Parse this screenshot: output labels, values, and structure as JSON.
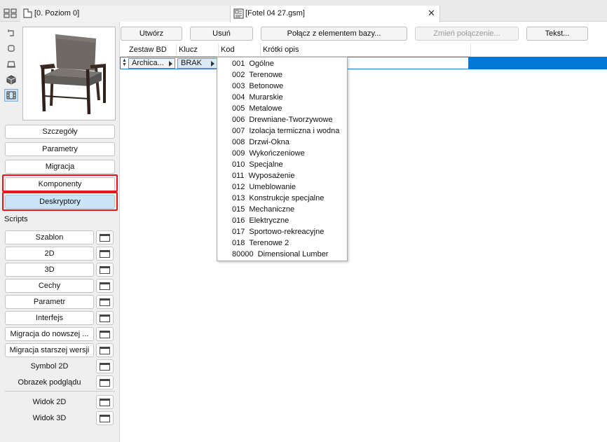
{
  "tabs": [
    {
      "label": "[0. Poziom 0]"
    },
    {
      "label": "[Fotel 04 27.gsm]"
    }
  ],
  "left": {
    "buttons": {
      "szczegoly": "Szczegóły",
      "parametry": "Parametry",
      "migracja": "Migracja",
      "komponenty": "Komponenty",
      "deskryptory": "Deskryptory"
    },
    "scripts_label": "Scripts",
    "scripts": {
      "szablon": "Szablon",
      "s2d": "2D",
      "s3d": "3D",
      "cechy": "Cechy",
      "parametr": "Parametr",
      "interfejs": "Interfejs",
      "migracja_nowsza": "Migracja do nowszej ...",
      "migracja_starsza": "Migracja starszej wersji",
      "symbol2d": "Symbol 2D",
      "obrazek": "Obrazek podglądu",
      "widok2d": "Widok 2D",
      "widok3d": "Widok 3D"
    }
  },
  "toolbar": {
    "utworz": "Utwórz",
    "usun": "Usuń",
    "polacz": "Połącz z elementem bazy...",
    "zmien": "Zmień połączenie...",
    "tekst": "Tekst..."
  },
  "table": {
    "headers": {
      "zestaw": "Zestaw BD",
      "klucz": "Klucz",
      "kod": "Kod",
      "opis": "Krótki opis"
    },
    "row": {
      "zestaw": "Archica...",
      "klucz": "BRAK"
    }
  },
  "dropdown": [
    {
      "code": "001",
      "label": "Ogólne"
    },
    {
      "code": "002",
      "label": "Terenowe"
    },
    {
      "code": "003",
      "label": "Betonowe"
    },
    {
      "code": "004",
      "label": "Murarskie"
    },
    {
      "code": "005",
      "label": "Metalowe"
    },
    {
      "code": "006",
      "label": "Drewniane-Tworzywowe"
    },
    {
      "code": "007",
      "label": "Izolacja termiczna i wodna"
    },
    {
      "code": "008",
      "label": "Drzwi-Okna"
    },
    {
      "code": "009",
      "label": "Wykończeniowe"
    },
    {
      "code": "010",
      "label": "Specjalne"
    },
    {
      "code": "011",
      "label": "Wyposażenie"
    },
    {
      "code": "012",
      "label": "Umeblowanie"
    },
    {
      "code": "013",
      "label": "Konstrukcje specjalne"
    },
    {
      "code": "015",
      "label": "Mechaniczne"
    },
    {
      "code": "016",
      "label": "Elektryczne"
    },
    {
      "code": "017",
      "label": "Sportowo-rekreacyjne"
    },
    {
      "code": "018",
      "label": "Terenowe 2"
    },
    {
      "code": "80000",
      "label": "Dimensional Lumber"
    }
  ],
  "colors": {
    "accent": "#0078d7",
    "highlight": "#e8141c",
    "selected_button": "#cce4f7"
  }
}
